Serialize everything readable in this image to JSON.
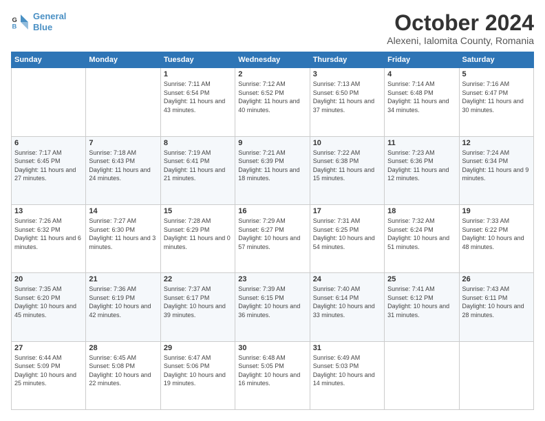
{
  "header": {
    "logo_line1": "General",
    "logo_line2": "Blue",
    "main_title": "October 2024",
    "subtitle": "Alexeni, Ialomita County, Romania"
  },
  "days_of_week": [
    "Sunday",
    "Monday",
    "Tuesday",
    "Wednesday",
    "Thursday",
    "Friday",
    "Saturday"
  ],
  "weeks": [
    [
      {
        "day": "",
        "info": ""
      },
      {
        "day": "",
        "info": ""
      },
      {
        "day": "1",
        "info": "Sunrise: 7:11 AM\nSunset: 6:54 PM\nDaylight: 11 hours and 43 minutes."
      },
      {
        "day": "2",
        "info": "Sunrise: 7:12 AM\nSunset: 6:52 PM\nDaylight: 11 hours and 40 minutes."
      },
      {
        "day": "3",
        "info": "Sunrise: 7:13 AM\nSunset: 6:50 PM\nDaylight: 11 hours and 37 minutes."
      },
      {
        "day": "4",
        "info": "Sunrise: 7:14 AM\nSunset: 6:48 PM\nDaylight: 11 hours and 34 minutes."
      },
      {
        "day": "5",
        "info": "Sunrise: 7:16 AM\nSunset: 6:47 PM\nDaylight: 11 hours and 30 minutes."
      }
    ],
    [
      {
        "day": "6",
        "info": "Sunrise: 7:17 AM\nSunset: 6:45 PM\nDaylight: 11 hours and 27 minutes."
      },
      {
        "day": "7",
        "info": "Sunrise: 7:18 AM\nSunset: 6:43 PM\nDaylight: 11 hours and 24 minutes."
      },
      {
        "day": "8",
        "info": "Sunrise: 7:19 AM\nSunset: 6:41 PM\nDaylight: 11 hours and 21 minutes."
      },
      {
        "day": "9",
        "info": "Sunrise: 7:21 AM\nSunset: 6:39 PM\nDaylight: 11 hours and 18 minutes."
      },
      {
        "day": "10",
        "info": "Sunrise: 7:22 AM\nSunset: 6:38 PM\nDaylight: 11 hours and 15 minutes."
      },
      {
        "day": "11",
        "info": "Sunrise: 7:23 AM\nSunset: 6:36 PM\nDaylight: 11 hours and 12 minutes."
      },
      {
        "day": "12",
        "info": "Sunrise: 7:24 AM\nSunset: 6:34 PM\nDaylight: 11 hours and 9 minutes."
      }
    ],
    [
      {
        "day": "13",
        "info": "Sunrise: 7:26 AM\nSunset: 6:32 PM\nDaylight: 11 hours and 6 minutes."
      },
      {
        "day": "14",
        "info": "Sunrise: 7:27 AM\nSunset: 6:30 PM\nDaylight: 11 hours and 3 minutes."
      },
      {
        "day": "15",
        "info": "Sunrise: 7:28 AM\nSunset: 6:29 PM\nDaylight: 11 hours and 0 minutes."
      },
      {
        "day": "16",
        "info": "Sunrise: 7:29 AM\nSunset: 6:27 PM\nDaylight: 10 hours and 57 minutes."
      },
      {
        "day": "17",
        "info": "Sunrise: 7:31 AM\nSunset: 6:25 PM\nDaylight: 10 hours and 54 minutes."
      },
      {
        "day": "18",
        "info": "Sunrise: 7:32 AM\nSunset: 6:24 PM\nDaylight: 10 hours and 51 minutes."
      },
      {
        "day": "19",
        "info": "Sunrise: 7:33 AM\nSunset: 6:22 PM\nDaylight: 10 hours and 48 minutes."
      }
    ],
    [
      {
        "day": "20",
        "info": "Sunrise: 7:35 AM\nSunset: 6:20 PM\nDaylight: 10 hours and 45 minutes."
      },
      {
        "day": "21",
        "info": "Sunrise: 7:36 AM\nSunset: 6:19 PM\nDaylight: 10 hours and 42 minutes."
      },
      {
        "day": "22",
        "info": "Sunrise: 7:37 AM\nSunset: 6:17 PM\nDaylight: 10 hours and 39 minutes."
      },
      {
        "day": "23",
        "info": "Sunrise: 7:39 AM\nSunset: 6:15 PM\nDaylight: 10 hours and 36 minutes."
      },
      {
        "day": "24",
        "info": "Sunrise: 7:40 AM\nSunset: 6:14 PM\nDaylight: 10 hours and 33 minutes."
      },
      {
        "day": "25",
        "info": "Sunrise: 7:41 AM\nSunset: 6:12 PM\nDaylight: 10 hours and 31 minutes."
      },
      {
        "day": "26",
        "info": "Sunrise: 7:43 AM\nSunset: 6:11 PM\nDaylight: 10 hours and 28 minutes."
      }
    ],
    [
      {
        "day": "27",
        "info": "Sunrise: 6:44 AM\nSunset: 5:09 PM\nDaylight: 10 hours and 25 minutes."
      },
      {
        "day": "28",
        "info": "Sunrise: 6:45 AM\nSunset: 5:08 PM\nDaylight: 10 hours and 22 minutes."
      },
      {
        "day": "29",
        "info": "Sunrise: 6:47 AM\nSunset: 5:06 PM\nDaylight: 10 hours and 19 minutes."
      },
      {
        "day": "30",
        "info": "Sunrise: 6:48 AM\nSunset: 5:05 PM\nDaylight: 10 hours and 16 minutes."
      },
      {
        "day": "31",
        "info": "Sunrise: 6:49 AM\nSunset: 5:03 PM\nDaylight: 10 hours and 14 minutes."
      },
      {
        "day": "",
        "info": ""
      },
      {
        "day": "",
        "info": ""
      }
    ]
  ]
}
